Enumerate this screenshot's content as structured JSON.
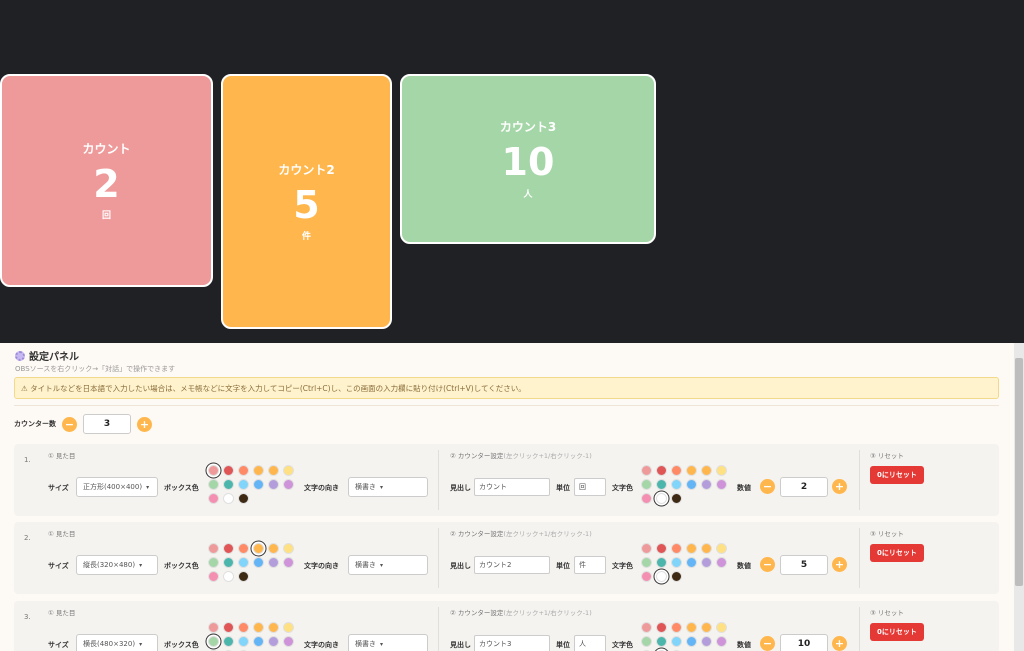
{
  "colors": {
    "background": "#1f2124",
    "accent": "#ffb74d",
    "danger": "#e53935",
    "panel": "#fdf9f4",
    "warning_bg": "#fff3cd"
  },
  "cards": [
    {
      "title": "カウント",
      "value": "2",
      "unit": "回",
      "color": "#ef9a9a"
    },
    {
      "title": "カウント2",
      "value": "5",
      "unit": "件",
      "color": "#ffb74d"
    },
    {
      "title": "カウント3",
      "value": "10",
      "unit": "人",
      "color": "#a5d6a7"
    }
  ],
  "panel": {
    "title": "設定パネル",
    "title_icon": "gear-icon",
    "subtitle": "OBSソースを右クリック→「対話」で操作できます",
    "warning": "⚠ タイトルなどを日本語で入力したい場合は、メモ帳などに文字を入力してコピー(Ctrl+C)し、この画面の入力欄に貼り付け(Ctrl+V)してください。",
    "counter_count_label": "カウンター数",
    "counter_count": "3",
    "minus": "−",
    "plus": "+"
  },
  "labels": {
    "section_appearance": "① 見た目",
    "section_counter": "② カウンター設定",
    "section_counter_hint": "(左クリック+1/右クリック-1)",
    "section_reset": "③ リセット",
    "size": "サイズ",
    "box_color": "ボックス色",
    "text_direction": "文字の向き",
    "heading": "見出し",
    "unit": "単位",
    "text_color": "文字色",
    "value": "数値",
    "reset_button": "0にリセット"
  },
  "palette": [
    "#ef9a9a",
    "#e05555",
    "#ff8a65",
    "#ffb74d",
    "#ffb74d",
    "#ffe082",
    "#a5d6a7",
    "#4db6ac",
    "#81d4fa",
    "#64b5f6",
    "#b39ddb",
    "#ce93d8",
    "#f48fb1",
    "#ffffff",
    "#3e2a14"
  ],
  "rows": [
    {
      "num": "1.",
      "size": "正方形(400×400)",
      "direction": "横書き",
      "heading": "カウント",
      "unit": "回",
      "value": "2",
      "box_selected": 0,
      "text_selected": 13
    },
    {
      "num": "2.",
      "size": "縦長(320×480)",
      "direction": "横書き",
      "heading": "カウント2",
      "unit": "件",
      "value": "5",
      "box_selected": 3,
      "text_selected": 13
    },
    {
      "num": "3.",
      "size": "横長(480×320)",
      "direction": "横書き",
      "heading": "カウント3",
      "unit": "人",
      "value": "10",
      "box_selected": 6,
      "text_selected": 13
    }
  ]
}
